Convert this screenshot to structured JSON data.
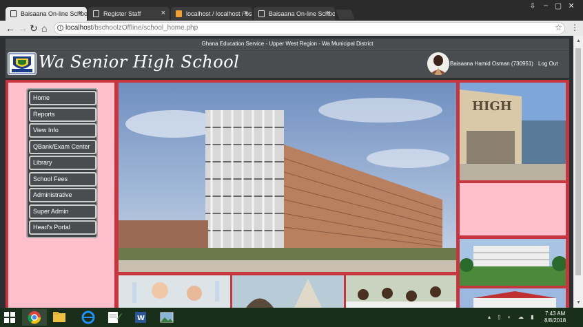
{
  "browser": {
    "tabs": [
      {
        "title": "Baisaana On-line School",
        "active": true
      },
      {
        "title": "Register Staff",
        "active": false
      },
      {
        "title": "localhost / localhost / bs",
        "active": false
      },
      {
        "title": "Baisaana On-line School",
        "active": false
      }
    ],
    "url_host": "localhost",
    "url_path": "/bschoolzOffline/school_home.php"
  },
  "page": {
    "topline": "Ghana Education Service - Upper West Region - Wa Municipal District",
    "school_name": "Wa Senior High School",
    "user_name": "Baisaana Hamid Osman (730951)",
    "logout": "Log Out",
    "menu": [
      "Home",
      "Reports",
      "View Info",
      "QBank/Exam Center",
      "Library",
      "School Fees",
      "Administrative",
      "Super Admin",
      "Head's Portal"
    ]
  },
  "taskbar": {
    "time": "7:43 AM",
    "date": "8/8/2018"
  },
  "colors": {
    "header": "#4a4d50",
    "accent_red": "#c7363e",
    "pink": "#ffc0cb"
  }
}
